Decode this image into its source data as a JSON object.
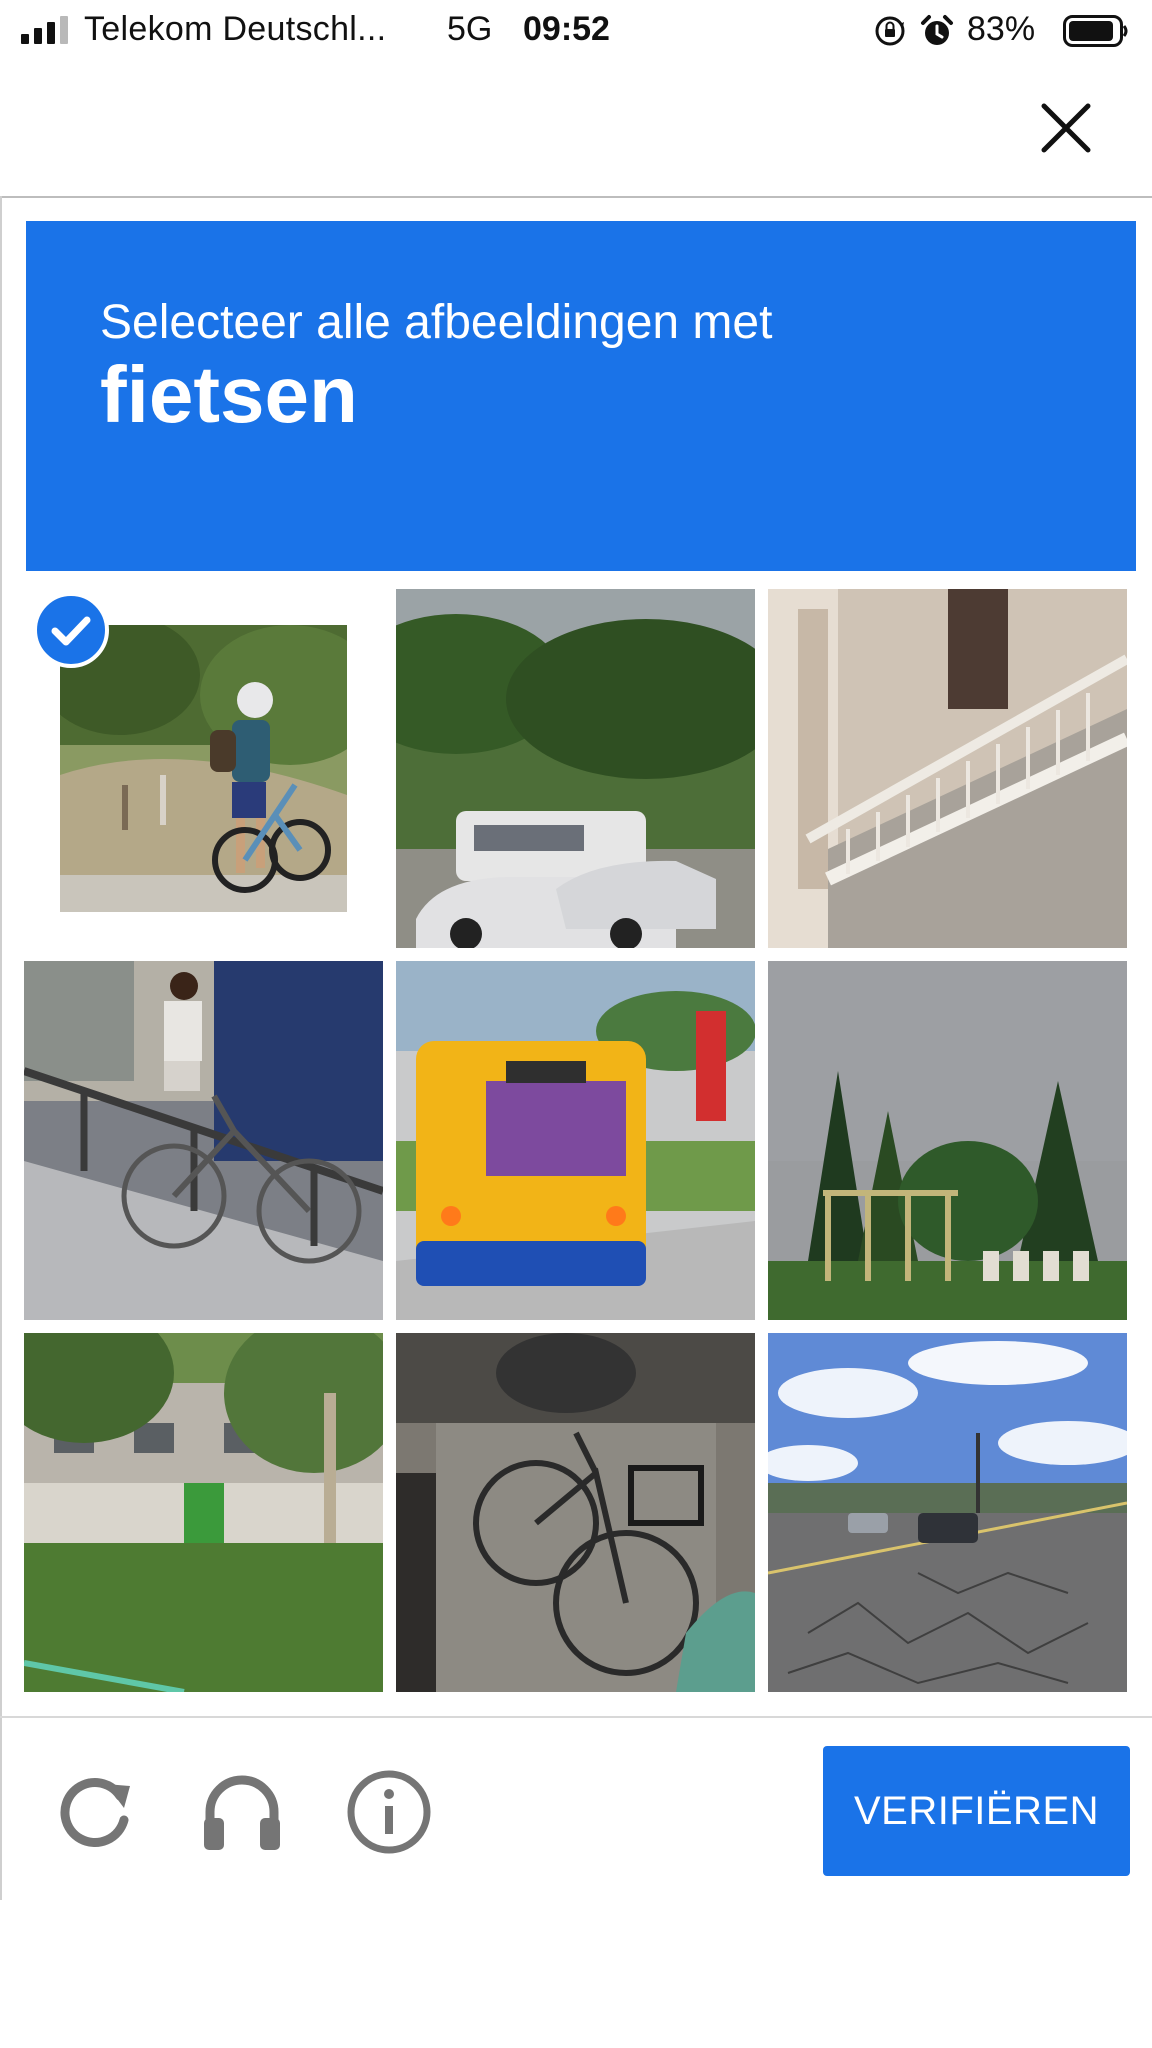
{
  "status_bar": {
    "carrier": "Telekom Deutschl...",
    "network": "5G",
    "time": "09:52",
    "battery_percent": "83%",
    "icons": [
      "signal-icon",
      "orientation-lock-icon",
      "alarm-icon",
      "battery-icon"
    ]
  },
  "topbar": {
    "close_icon": "close-icon"
  },
  "challenge": {
    "instruction": "Selecteer alle afbeeldingen met",
    "target": "fietsen",
    "tiles": [
      {
        "content": "cyclist-with-bike",
        "selected": true
      },
      {
        "content": "parked-cars-and-bus",
        "selected": false
      },
      {
        "content": "building-balcony",
        "selected": false
      },
      {
        "content": "person-with-bicycle-on-street",
        "selected": false
      },
      {
        "content": "yellow-bus",
        "selected": false
      },
      {
        "content": "trees-and-fence",
        "selected": false
      },
      {
        "content": "building-with-trees",
        "selected": false
      },
      {
        "content": "bicycle-with-basket",
        "selected": false
      },
      {
        "content": "road-with-traffic",
        "selected": false
      }
    ]
  },
  "footer": {
    "icons": [
      "reload-icon",
      "headphones-icon",
      "info-icon"
    ],
    "verify_label": "VERIFIËREN"
  },
  "colors": {
    "accent": "#1a73e8",
    "icon_gray": "#757575"
  }
}
